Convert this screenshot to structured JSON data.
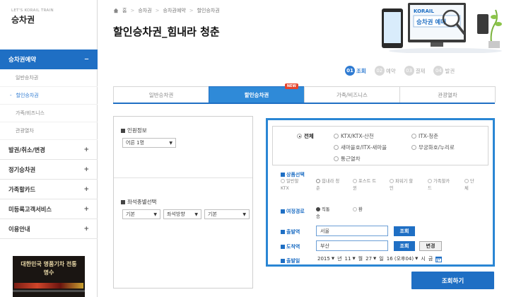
{
  "brand": {
    "subtitle": "LET'S KORAIL TRAIN",
    "title": "승차권"
  },
  "sidebar": {
    "head": {
      "label": "승차권예약",
      "toggle": "−"
    },
    "sub_items": [
      {
        "label": "일반승차권"
      },
      {
        "label": "할인승차권",
        "marker": "-"
      },
      {
        "label": "가족/비즈니스"
      },
      {
        "label": "관광열차"
      }
    ],
    "items": [
      {
        "label": "발권/취소/변경",
        "toggle": "+"
      },
      {
        "label": "정기승차권",
        "toggle": "+"
      },
      {
        "label": "가족할카드",
        "toggle": "+"
      },
      {
        "label": "미등록고객서비스",
        "toggle": "+"
      },
      {
        "label": "이용안내",
        "toggle": "+"
      }
    ],
    "banner_text": "대한민국 명품기차 전통명수"
  },
  "breadcrumb": {
    "items": [
      "홈",
      "승차권",
      "승차권예약",
      "할인승차권"
    ],
    "separator": ">"
  },
  "page_title": "할인승차권_힘내라 청춘",
  "header_illustration": {
    "logo": "KORAIL",
    "caption": "승차권 예매"
  },
  "steps": [
    {
      "num": "01",
      "label": "조회",
      "active": true
    },
    {
      "num": "02",
      "label": "예약"
    },
    {
      "num": "03",
      "label": "결제"
    },
    {
      "num": "04",
      "label": "발권"
    }
  ],
  "tabs": [
    {
      "label": "일반승차권"
    },
    {
      "label": "할인승차권",
      "badge": "NEW",
      "active": true
    },
    {
      "label": "가족/비즈니스"
    },
    {
      "label": "관광열차"
    }
  ],
  "left_panel": {
    "passenger": {
      "label": "인원정보",
      "value": "어른 1명"
    },
    "seat": {
      "label": "좌석종별선택",
      "values": [
        "기본",
        "좌석방향",
        "기본"
      ]
    }
  },
  "right_panel": {
    "train_types": [
      {
        "label": "전체",
        "checked": true
      },
      {
        "label": "KTX/KTX-산천"
      },
      {
        "label": "ITX-청춘"
      },
      {
        "label": "새마을호/ITX-새마을"
      },
      {
        "label": "무궁화호/누리로"
      },
      {
        "label": "통근열차"
      }
    ],
    "product": {
      "label": "상품선택",
      "options": [
        {
          "line1": "일반할",
          "line2": "KTX"
        },
        {
          "line1": "힘내라 청",
          "line2": "춘"
        },
        {
          "line1": "포스트 트",
          "line2": "윈"
        },
        {
          "line1": "파워기 할",
          "line2": "인"
        },
        {
          "line1": "가족할카",
          "line2": "드"
        },
        {
          "line1": "단",
          "line2": "체"
        }
      ]
    },
    "route": {
      "label": "여정경로",
      "options": [
        {
          "line1": "직통",
          "line2": "승",
          "checked": true
        },
        {
          "line1": "환",
          "line2": ""
        }
      ]
    },
    "departure": {
      "label": "출발역",
      "value": "서울",
      "button": "조회"
    },
    "arrival": {
      "label": "도착역",
      "value": "부산",
      "button": "조회",
      "swap": "변경"
    },
    "date": {
      "label": "출발일",
      "year": "2015",
      "year_unit": "년",
      "month": "11",
      "month_unit": "월",
      "day": "27",
      "day_unit": "일",
      "weekday": "16 (오후04)",
      "hour_unit": "시",
      "trail": "금"
    }
  },
  "search_button": "조회하기"
}
